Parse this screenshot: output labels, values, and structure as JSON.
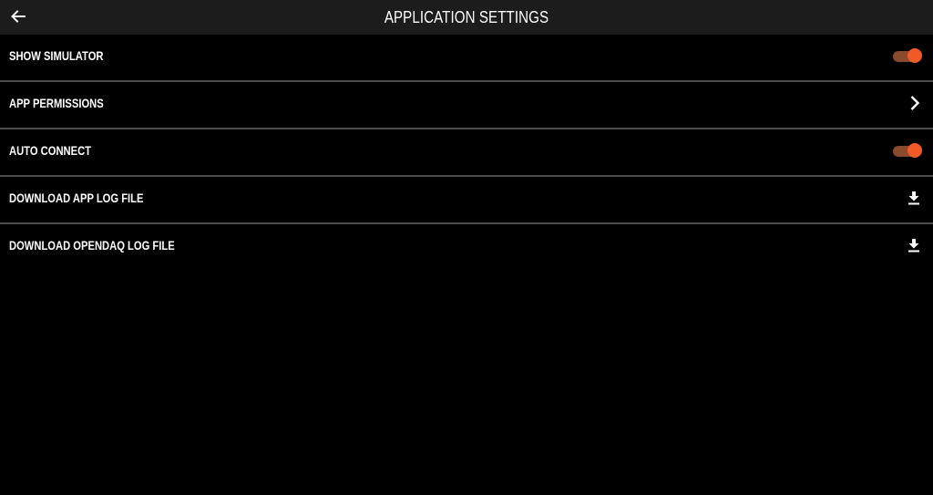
{
  "header": {
    "title": "APPLICATION SETTINGS",
    "back_icon": "arrow-left-icon"
  },
  "colors": {
    "background": "#000000",
    "header_background": "#1c1c1c",
    "divider": "#4a4a4a",
    "accent": "#f05a28",
    "accent_track": "#8a4a2e",
    "text": "#ffffff"
  },
  "settings": {
    "items": [
      {
        "label": "SHOW SIMULATOR",
        "control": "toggle",
        "value": true
      },
      {
        "label": "APP PERMISSIONS",
        "control": "chevron-right-icon"
      },
      {
        "label": "AUTO CONNECT",
        "control": "toggle",
        "value": true
      },
      {
        "label": "DOWNLOAD APP LOG FILE",
        "control": "download-icon"
      },
      {
        "label": "DOWNLOAD OPENDAQ LOG FILE",
        "control": "download-icon"
      }
    ]
  }
}
